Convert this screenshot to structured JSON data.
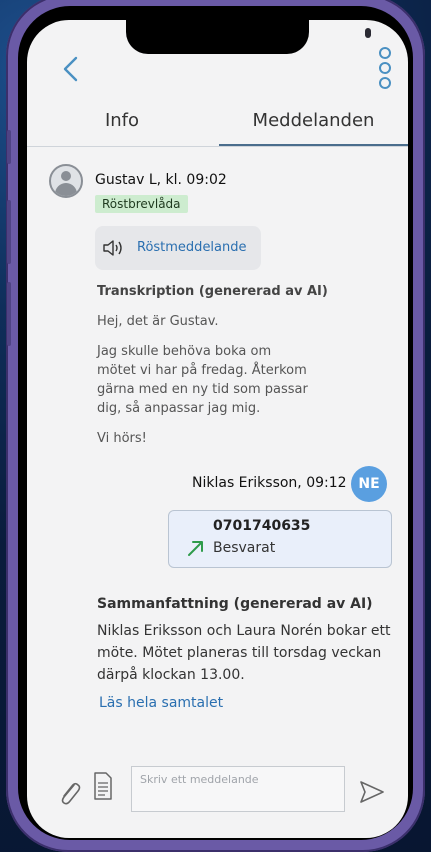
{
  "header": {
    "back_icon": "chevron-left-icon",
    "more_icon": "vertical-dots-icon"
  },
  "tabs": [
    {
      "label": "Info",
      "active": false
    },
    {
      "label": "Meddelanden",
      "active": true
    }
  ],
  "message": {
    "sender": "Gustav L, kl. 09:02",
    "badge": "Röstbrevlåda",
    "voice_label": "Röstmeddelande",
    "transcription_title": "Transkription (genererad av AI)",
    "transcription_lines": [
      "Hej, det är Gustav.",
      "Jag skulle behöva boka om mötet vi har på fredag. Återkom gärna med en ny tid som passar dig, så anpassar jag mig.",
      "Vi hörs!"
    ]
  },
  "reply": {
    "sender": "Niklas Eriksson, 09:12",
    "initials": "NE",
    "call_number": "0701740635",
    "call_status": "Besvarat"
  },
  "summary": {
    "title": "Sammanfattning (genererad av AI)",
    "text": "Niklas Eriksson och Laura Norén bokar ett möte. Mötet planeras till torsdag veckan därpå klockan 13.00.",
    "link": "Läs hela samtalet"
  },
  "composer": {
    "placeholder": "Skriv ett meddelande"
  },
  "colors": {
    "accent": "#2a6fb0",
    "badge_bg": "#cdeccf",
    "avatar_ne": "#5a9fe0",
    "frame": "#6a5aa6"
  }
}
